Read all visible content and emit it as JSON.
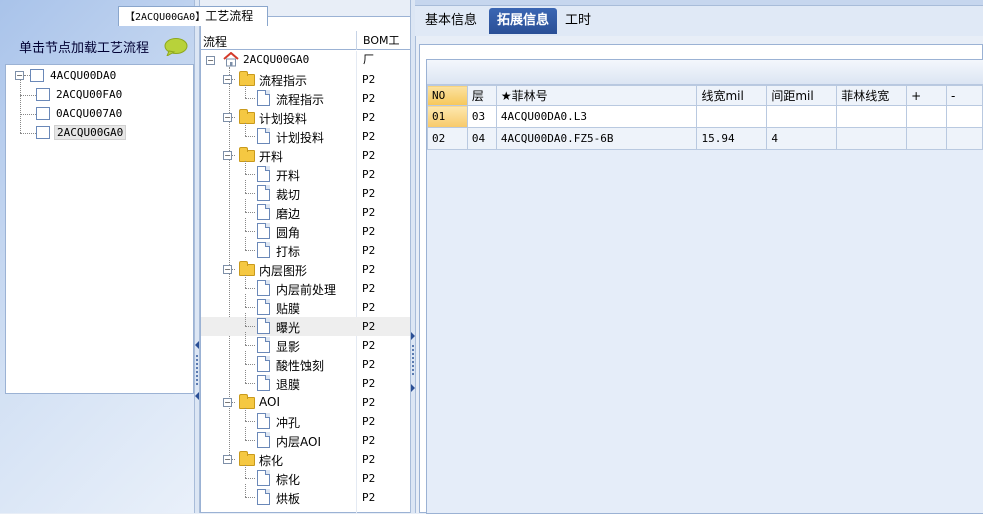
{
  "left": {
    "title_code": "【2ACQU00GA0】",
    "title_text": "工艺流程",
    "header": "单击节点加载工艺流程",
    "tree": {
      "root": "4ACQU00DA0",
      "children": [
        "2ACQU00FA0",
        "0ACQU007A0",
        "2ACQU00GA0"
      ]
    }
  },
  "middle": {
    "col_flow": "流程",
    "col_bom": "BOM工厂",
    "root": "2ACQU00GA0",
    "rows": [
      {
        "label": "流程指示",
        "bom": "P2",
        "type": "folder"
      },
      {
        "label": "流程指示",
        "bom": "P2",
        "type": "page"
      },
      {
        "label": "计划投料",
        "bom": "P2",
        "type": "folder"
      },
      {
        "label": "计划投料",
        "bom": "P2",
        "type": "page"
      },
      {
        "label": "开料",
        "bom": "P2",
        "type": "folder"
      },
      {
        "label": "开料",
        "bom": "P2",
        "type": "page"
      },
      {
        "label": "裁切",
        "bom": "P2",
        "type": "page"
      },
      {
        "label": "磨边",
        "bom": "P2",
        "type": "page"
      },
      {
        "label": "圆角",
        "bom": "P2",
        "type": "page"
      },
      {
        "label": "打标",
        "bom": "P2",
        "type": "page"
      },
      {
        "label": "内层图形",
        "bom": "P2",
        "type": "folder"
      },
      {
        "label": "内层前处理",
        "bom": "P2",
        "type": "page"
      },
      {
        "label": "贴膜",
        "bom": "P2",
        "type": "page"
      },
      {
        "label": "曝光",
        "bom": "P2",
        "type": "page"
      },
      {
        "label": "显影",
        "bom": "P2",
        "type": "page"
      },
      {
        "label": "酸性蚀刻",
        "bom": "P2",
        "type": "page"
      },
      {
        "label": "退膜",
        "bom": "P2",
        "type": "page"
      },
      {
        "label": "AOI",
        "bom": "P2",
        "type": "folder"
      },
      {
        "label": "冲孔",
        "bom": "P2",
        "type": "page"
      },
      {
        "label": "内层AOI",
        "bom": "P2",
        "type": "page"
      },
      {
        "label": "棕化",
        "bom": "P2",
        "type": "folder"
      },
      {
        "label": "棕化",
        "bom": "P2",
        "type": "page"
      },
      {
        "label": "烘板",
        "bom": "P2",
        "type": "page"
      }
    ]
  },
  "tabs": [
    "基本信息",
    "拓展信息",
    "工时"
  ],
  "active_tab": 1,
  "table": {
    "headers": [
      "NO",
      "层",
      "★菲林号",
      "线宽mil",
      "间距mil",
      "菲林线宽",
      "+",
      "-"
    ],
    "rows": [
      [
        "01",
        "03",
        "4ACQU00DA0.L3",
        "",
        "",
        "",
        "",
        ""
      ],
      [
        "02",
        "04",
        "4ACQU00DA0.FZ5-6B",
        "15.94",
        "4",
        "",
        "",
        ""
      ]
    ]
  }
}
